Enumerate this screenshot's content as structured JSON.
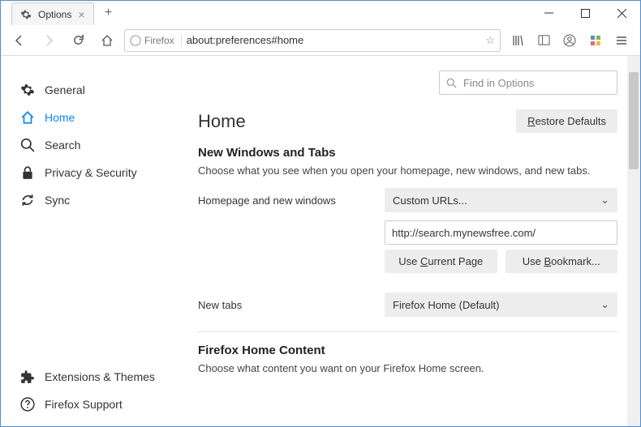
{
  "window": {
    "tab_title": "Options",
    "url_identity": "Firefox",
    "url": "about:preferences#home"
  },
  "search": {
    "placeholder": "Find in Options"
  },
  "sidebar": {
    "items": [
      {
        "label": "General"
      },
      {
        "label": "Home"
      },
      {
        "label": "Search"
      },
      {
        "label": "Privacy & Security"
      },
      {
        "label": "Sync"
      }
    ],
    "bottom": [
      {
        "label": "Extensions & Themes"
      },
      {
        "label": "Firefox Support"
      }
    ]
  },
  "page": {
    "title": "Home",
    "restore_btn_prefix": "R",
    "restore_btn_rest": "estore Defaults"
  },
  "section1": {
    "title": "New Windows and Tabs",
    "sub": "Choose what you see when you open your homepage, new windows, and new tabs.",
    "homepage_label": "Homepage and new windows",
    "homepage_select": "Custom URLs...",
    "homepage_value": "http://search.mynewsfree.com/",
    "use_current_prefix": "Use ",
    "use_current_u": "C",
    "use_current_rest": "urrent Page",
    "use_bookmark_prefix": "Use ",
    "use_bookmark_u": "B",
    "use_bookmark_rest": "ookmark...",
    "newtabs_label": "New tabs",
    "newtabs_select": "Firefox Home (Default)"
  },
  "section2": {
    "title": "Firefox Home Content",
    "sub": "Choose what content you want on your Firefox Home screen."
  }
}
